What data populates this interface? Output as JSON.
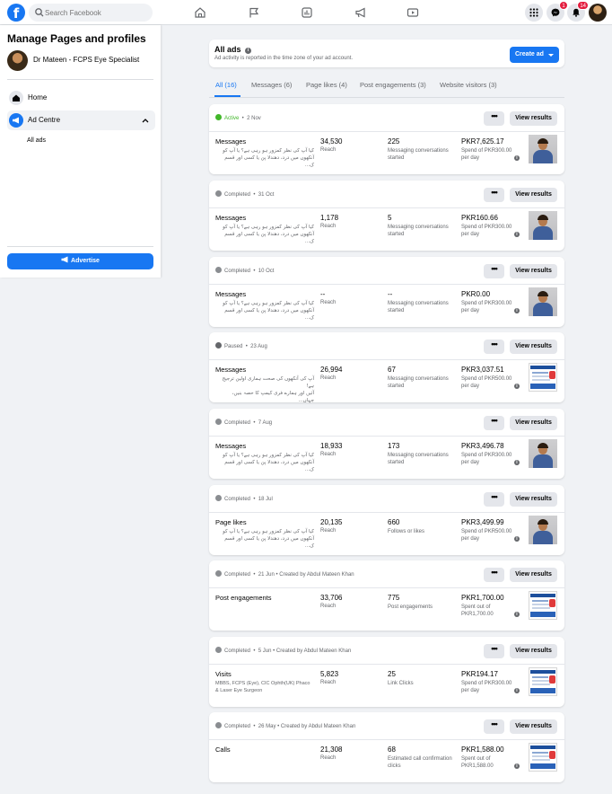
{
  "topbar": {
    "logo": "f",
    "search_placeholder": "Search Facebook",
    "messenger_badge": "1",
    "notifications_badge": "14"
  },
  "sidebar": {
    "title": "Manage Pages and profiles",
    "profile_name": "Dr Mateen - FCPS Eye Specialist",
    "home_label": "Home",
    "ad_centre_label": "Ad Centre",
    "all_ads_label": "All ads",
    "advertise_label": "Advertise"
  },
  "header": {
    "title": "All ads",
    "subtitle": "Ad activity is reported in the time zone of your ad account.",
    "create_ad_label": "Create ad"
  },
  "tabs": [
    {
      "label": "All (16)"
    },
    {
      "label": "Messages (6)"
    },
    {
      "label": "Page likes (4)"
    },
    {
      "label": "Post engagements (3)"
    },
    {
      "label": "Website visitors (3)"
    }
  ],
  "colors": {
    "accent": "#1877f2",
    "active": "#42b72a",
    "completed": "#8a8d91",
    "paused": "#65676b"
  },
  "ads": [
    {
      "status": "Active",
      "meta": "2 Nov",
      "type": "Messages",
      "text1": "کیا آپ کی نظر کمزور ہو رہی ہے؟ یا آپ کو",
      "text2": "آنکھوں میں درد، دھندلا پن یا کسی اور قسم ک...",
      "m1": "34,530",
      "m1_label": "Reach",
      "m2": "225",
      "m2_label": "Messaging conversations started",
      "spend": "PKR7,625.17",
      "spend_label": "Spend of PKR300.00 per day",
      "more": "•••",
      "view": "View results"
    },
    {
      "status": "Completed",
      "meta": "31 Oct",
      "type": "Messages",
      "text1": "کیا آپ کی نظر کمزور ہو رہی ہے؟ یا آپ کو",
      "text2": "آنکھوں میں درد، دھندلا پن یا کسی اور قسم ک...",
      "m1": "1,178",
      "m1_label": "Reach",
      "m2": "5",
      "m2_label": "Messaging conversations started",
      "spend": "PKR160.66",
      "spend_label": "Spend of PKR300.00 per day",
      "more": "•••",
      "view": "View results"
    },
    {
      "status": "Completed",
      "meta": "10 Oct",
      "type": "Messages",
      "text1": "کیا آپ کی نظر کمزور ہو رہی ہے؟ یا آپ کو",
      "text2": "آنکھوں میں درد، دھندلا پن یا کسی اور قسم ک...",
      "m1": "--",
      "m1_label": "Reach",
      "m2": "--",
      "m2_label": "Messaging conversations started",
      "spend": "PKR0.00",
      "spend_label": "Spend of PKR300.00 per day",
      "more": "•••",
      "view": "View results"
    },
    {
      "status": "Paused",
      "meta": "23 Aug",
      "type": "Messages",
      "text1": "آپ کی آنکھوں کی صحت ہماری اولین ترجیح ہے!",
      "text2": "آئیں اور ہمارے فری کیمپ کا حصہ بنیں، جہاں...",
      "m1": "26,994",
      "m1_label": "Reach",
      "m2": "67",
      "m2_label": "Messaging conversations started",
      "spend": "PKR3,037.51",
      "spend_label": "Spend of PKR500.00 per day",
      "more": "•••",
      "view": "View results"
    },
    {
      "status": "Completed",
      "meta": "7 Aug",
      "type": "Messages",
      "text1": "کیا آپ کی نظر کمزور ہو رہی ہے؟ یا آپ کو",
      "text2": "آنکھوں میں درد، دھندلا پن یا کسی اور قسم ک...",
      "m1": "18,933",
      "m1_label": "Reach",
      "m2": "173",
      "m2_label": "Messaging conversations started",
      "spend": "PKR3,496.78",
      "spend_label": "Spend of PKR300.00 per day",
      "more": "•••",
      "view": "View results"
    },
    {
      "status": "Completed",
      "meta": "18 Jul",
      "type": "Page likes",
      "text1": "کیا آپ کی نظر کمزور ہو رہی ہے؟ یا آپ کو",
      "text2": "آنکھوں میں درد، دھندلا پن یا کسی اور قسم ک...",
      "m1": "20,135",
      "m1_label": "Reach",
      "m2": "660",
      "m2_label": "Follows or likes",
      "spend": "PKR3,499.99",
      "spend_label": "Spend of PKR500.00 per day",
      "more": "•••",
      "view": "View results"
    },
    {
      "status": "Completed",
      "meta": "21 Jun  •  Created by Abdul Mateen Khan",
      "type": "Post engagements",
      "text1": "",
      "text2": "",
      "m1": "33,706",
      "m1_label": "Reach",
      "m2": "775",
      "m2_label": "Post engagements",
      "spend": "PKR1,700.00",
      "spend_label": "Spent out of PKR1,700.00",
      "more": "•••",
      "view": "View results"
    },
    {
      "status": "Completed",
      "meta": "5 Jun  •  Created by Abdul Mateen Khan",
      "type": "Visits",
      "text1": "MBBS, FCPS (Eye), CIC Ophth(UK) Phaco",
      "text2": "& Laser Eye Surgeon",
      "m1": "5,823",
      "m1_label": "Reach",
      "m2": "25",
      "m2_label": "Link Clicks",
      "spend": "PKR194.17",
      "spend_label": "Spend of PKR300.00 per day",
      "more": "•••",
      "view": "View results"
    },
    {
      "status": "Completed",
      "meta": "26 May  •  Created by Abdul Mateen Khan",
      "type": "Calls",
      "text1": "",
      "text2": "",
      "m1": "21,308",
      "m1_label": "Reach",
      "m2": "68",
      "m2_label": "Estimated call confirmation clicks",
      "spend": "PKR1,588.00",
      "spend_label": "Spent out of PKR1,588.00",
      "more": "•••",
      "view": "View results"
    }
  ]
}
